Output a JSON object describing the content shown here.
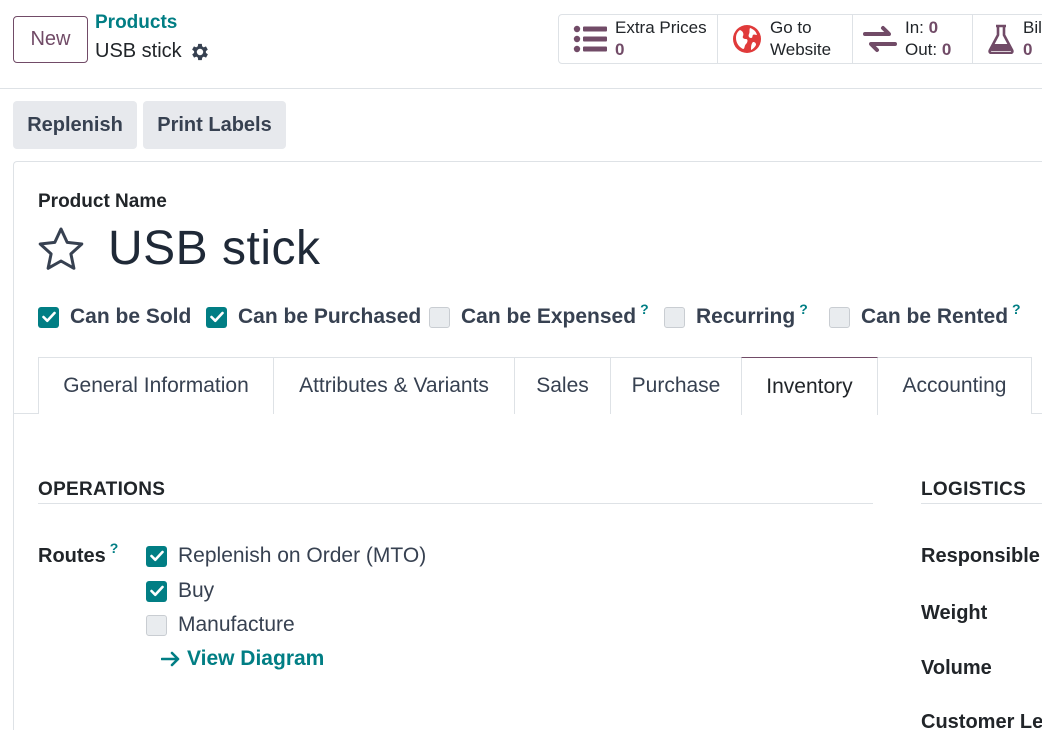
{
  "control_panel": {
    "new_label": "New",
    "breadcrumb": "Products",
    "record_title": "USB stick",
    "stat_buttons": {
      "extra_prices": {
        "label": "Extra Prices",
        "value": "0",
        "icon": "list-icon"
      },
      "go_to_website": {
        "line1": "Go to",
        "line2": "Website",
        "icon": "globe-icon"
      },
      "in_out": {
        "in_label": "In:",
        "in_value": "0",
        "out_label": "Out:",
        "out_value": "0",
        "icon": "transfer-arrows-icon"
      },
      "bill": {
        "label": "Bill",
        "value": "0",
        "icon": "flask-icon"
      }
    }
  },
  "actions": {
    "replenish": "Replenish",
    "print_labels": "Print Labels"
  },
  "form": {
    "product_name_label": "Product Name",
    "product_name": "USB stick",
    "checkboxes": [
      {
        "label": "Can be Sold",
        "checked": true,
        "help": ""
      },
      {
        "label": "Can be Purchased",
        "checked": true,
        "help": ""
      },
      {
        "label": "Can be Expensed",
        "checked": false,
        "help": "?"
      },
      {
        "label": "Recurring",
        "checked": false,
        "help": "?"
      },
      {
        "label": "Can be Rented",
        "checked": false,
        "help": "?"
      }
    ],
    "tabs": [
      {
        "label": "General Information",
        "active": false
      },
      {
        "label": "Attributes & Variants",
        "active": false
      },
      {
        "label": "Sales",
        "active": false
      },
      {
        "label": "Purchase",
        "active": false
      },
      {
        "label": "Inventory",
        "active": true
      },
      {
        "label": "Accounting",
        "active": false
      }
    ]
  },
  "inventory": {
    "operations_title": "OPERATIONS",
    "routes_label": "Routes",
    "routes_help": "?",
    "routes": [
      {
        "label": "Replenish on Order (MTO)",
        "checked": true
      },
      {
        "label": "Buy",
        "checked": true
      },
      {
        "label": "Manufacture",
        "checked": false
      }
    ],
    "view_diagram": "View Diagram",
    "logistics_title": "LOGISTICS",
    "logistics_fields": {
      "responsible": "Responsible",
      "responsible_help": "?",
      "weight": "Weight",
      "volume": "Volume",
      "customer_lead": "Customer Lea"
    }
  },
  "colors": {
    "brand": "#714b67",
    "accent": "#017e84",
    "checkbox_on": "#017e84"
  }
}
